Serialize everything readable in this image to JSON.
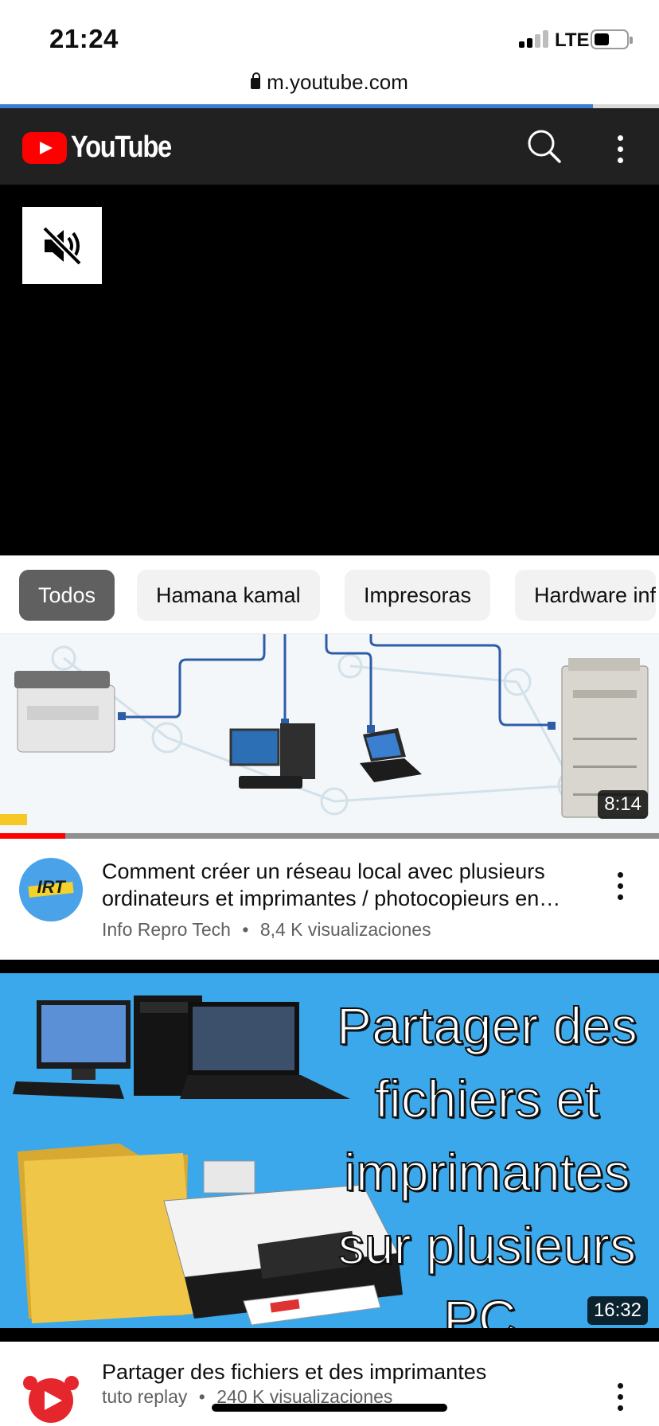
{
  "status_bar": {
    "time": "21:24",
    "network": "LTE",
    "signal_bars_active": 2,
    "signal_bars_total": 4,
    "battery_level": 0.35
  },
  "browser": {
    "url": "m.youtube.com",
    "load_progress": 0.9
  },
  "header": {
    "logo_text": "YouTube",
    "logo_icon": "youtube-play-logo",
    "search_icon": "search-icon",
    "menu_icon": "more-vert-icon"
  },
  "player": {
    "mute_icon": "volume-muted-icon"
  },
  "chips": [
    {
      "label": "Todos",
      "active": true
    },
    {
      "label": "Hamana kamal",
      "active": false
    },
    {
      "label": "Impresoras",
      "active": false
    },
    {
      "label": "Hardware inf",
      "active": false
    }
  ],
  "videos": [
    {
      "duration": "8:14",
      "watched_fraction": 0.1,
      "title": "Comment créer un réseau local avec plusieurs ordinateurs et imprimantes / photocopieurs en…",
      "channel": "Info Repro Tech",
      "separator": "•",
      "views": "8,4 K visualizaciones",
      "avatar_text": "IRT"
    },
    {
      "duration": "16:32",
      "thumbnail_text": [
        "Partager des",
        "fichiers et",
        "imprimantes",
        "sur plusieurs",
        "PC."
      ],
      "title": "Partager des fichiers et des imprimantes",
      "channel": "tuto replay",
      "separator": "•",
      "views": "240 K visualizaciones"
    }
  ],
  "colors": {
    "brand_red": "#ff0000",
    "header_bg": "#212121",
    "chip_active": "#606060",
    "chip_bg": "#f2f2f2",
    "progress_blue": "#3c7dd6"
  }
}
